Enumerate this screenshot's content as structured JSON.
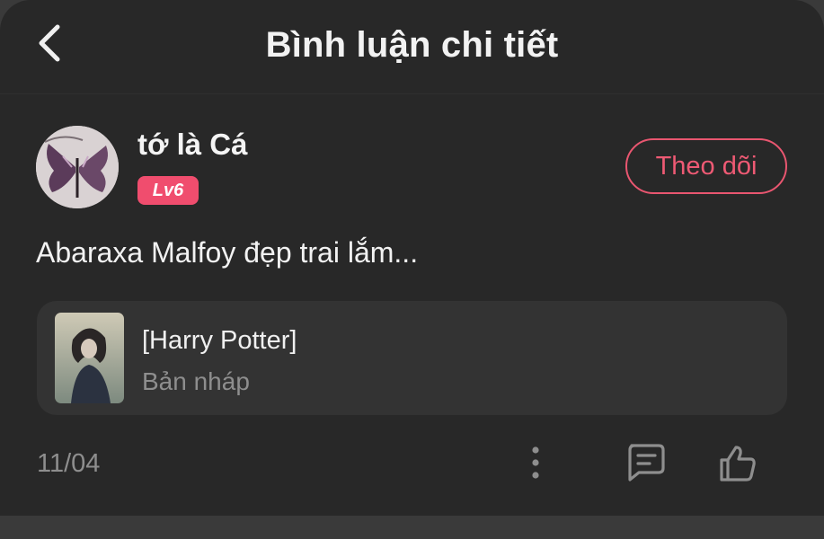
{
  "header": {
    "title": "Bình luận chi tiết",
    "back_icon": "chevron-left-icon"
  },
  "user": {
    "name": "tớ là Cá",
    "level": "Lv6",
    "follow_label": "Theo dõi"
  },
  "comment": {
    "text": "Abaraxa Malfoy đẹp trai lắm...",
    "date": "11/04"
  },
  "story": {
    "title": "[Harry Potter]",
    "status": "Bản nháp"
  },
  "actions": {
    "icons": [
      "more-vertical-icon",
      "comment-icon",
      "thumbs-up-icon"
    ]
  },
  "colors": {
    "accent": "#ee5a74",
    "badge": "#f04d6e",
    "background": "#282828",
    "card": "#333333"
  }
}
